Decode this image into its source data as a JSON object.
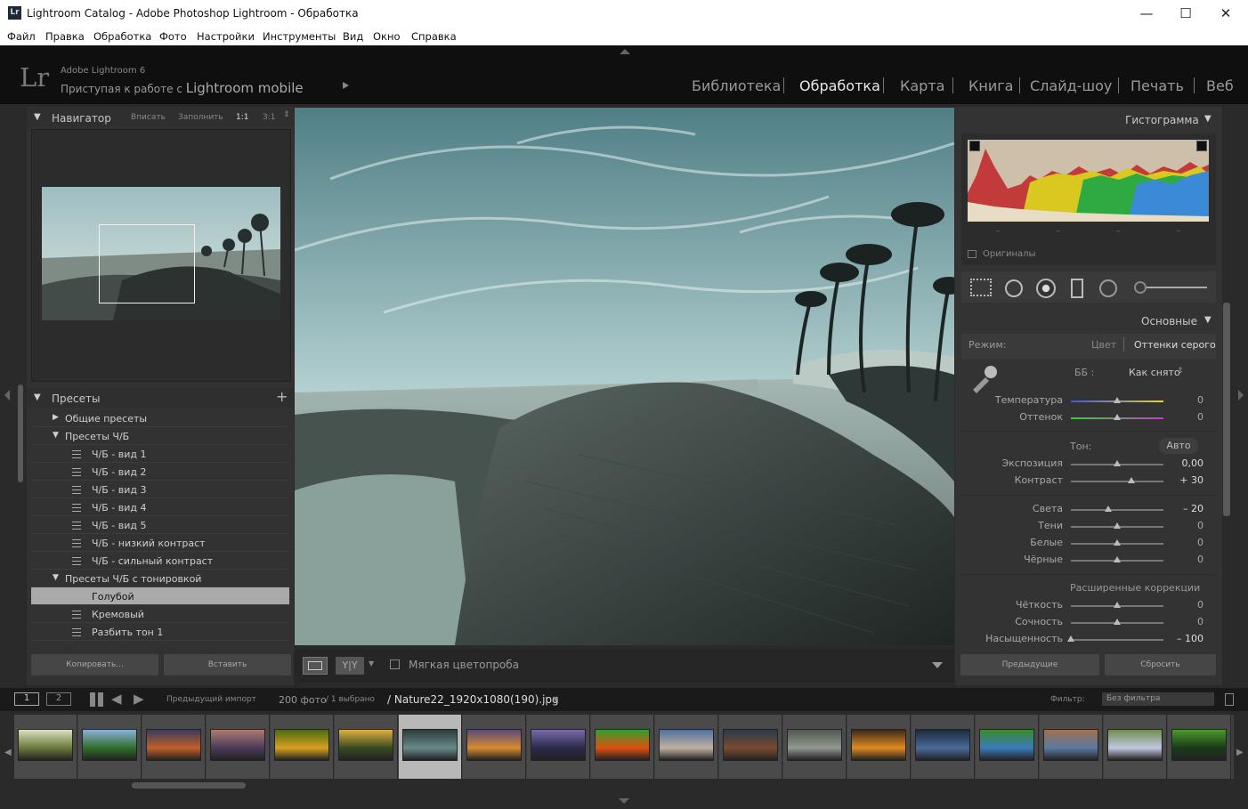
{
  "window": {
    "title": "Lightroom Catalog - Adobe Photoshop Lightroom - Обработка",
    "minimize": "—",
    "maximize": "☐",
    "close": "✕"
  },
  "menu": [
    "Файл",
    "Правка",
    "Обработка",
    "Фото",
    "Настройки",
    "Инструменты",
    "Вид",
    "Окно",
    "Справка"
  ],
  "identity": {
    "app": "Adobe Lightroom 6",
    "tagline_prefix": "Приступая к работе с",
    "tagline_mobile": "Lightroom mobile",
    "logo": "Lr"
  },
  "modules": [
    "Библиотека",
    "Обработка",
    "Карта",
    "Книга",
    "Слайд-шоу",
    "Печать",
    "Веб"
  ],
  "active_module": "Обработка",
  "navigator": {
    "title": "Навигатор",
    "fit": "Вписать",
    "fill": "Заполнить",
    "one": "1:1",
    "three": "3:1"
  },
  "presets": {
    "title": "Пресеты",
    "add": "+",
    "items": [
      {
        "label": "Общие пресеты",
        "type": "folder",
        "open": false
      },
      {
        "label": "Пресеты Ч/Б",
        "type": "folder",
        "open": true
      },
      {
        "label": "Ч/Б - вид 1",
        "type": "item"
      },
      {
        "label": "Ч/Б - вид 2",
        "type": "item"
      },
      {
        "label": "Ч/Б - вид 3",
        "type": "item"
      },
      {
        "label": "Ч/Б - вид 4",
        "type": "item"
      },
      {
        "label": "Ч/Б - вид 5",
        "type": "item"
      },
      {
        "label": "Ч/Б - низкий контраст",
        "type": "item"
      },
      {
        "label": "Ч/Б - сильный контраст",
        "type": "item"
      },
      {
        "label": "Пресеты Ч/Б с тонировкой",
        "type": "folder",
        "open": true
      },
      {
        "label": "Голубой",
        "type": "item",
        "selected": true
      },
      {
        "label": "Кремовый",
        "type": "item"
      },
      {
        "label": "Разбить тон 1",
        "type": "item"
      }
    ]
  },
  "left_buttons": {
    "copy": "Копировать...",
    "paste": "Вставить"
  },
  "toolbar": {
    "soft_proof": "Мягкая цветопроба",
    "yy": "Y|Y"
  },
  "histogram": {
    "title": "Гистограмма",
    "originals": "Оригиналы",
    "dashes": [
      "–",
      "–",
      "–",
      "–"
    ]
  },
  "basic": {
    "title": "Основные",
    "mode_label": "Режим:",
    "mode_color": "Цвет",
    "mode_gray": "Оттенки серого",
    "wb_label": "ББ :",
    "wb_value": "Как снято",
    "tone_label": "Тон:",
    "auto": "Авто",
    "adv_label": "Расширенные коррекции",
    "sliders": [
      {
        "label": "Температура",
        "value": "0",
        "pos": 0.5,
        "track": "temp"
      },
      {
        "label": "Оттенок",
        "value": "0",
        "pos": 0.5,
        "track": "tint"
      },
      {
        "label": "Экспозиция",
        "value": "0,00",
        "pos": 0.5
      },
      {
        "label": "Контраст",
        "value": "+ 30",
        "pos": 0.65
      },
      {
        "label": "Света",
        "value": "– 20",
        "pos": 0.4
      },
      {
        "label": "Тени",
        "value": "0",
        "pos": 0.5
      },
      {
        "label": "Белые",
        "value": "0",
        "pos": 0.5
      },
      {
        "label": "Чёрные",
        "value": "0",
        "pos": 0.5
      },
      {
        "label": "Чёткость",
        "value": "0",
        "pos": 0.5
      },
      {
        "label": "Сочность",
        "value": "0",
        "pos": 0.5
      },
      {
        "label": "Насыщенность",
        "value": "– 100",
        "pos": 0.0
      }
    ]
  },
  "right_buttons": {
    "previous": "Предыдущие",
    "reset": "Сбросить"
  },
  "filmstrip_header": {
    "view1": "1",
    "view2": "2",
    "source": "Предыдущий импорт",
    "count": "200 фото",
    "selected": "/ 1 выбрано",
    "filename": "/ Nature22_1920x1080(190).jpg",
    "filter_label": "Фильтр:",
    "filter_value": "Без фильтра"
  },
  "thumbs": [
    {
      "c1": "#6b7a3a",
      "c2": "#d8e0c0"
    },
    {
      "c1": "#2f6e2a",
      "c2": "#8ab0d8"
    },
    {
      "c1": "#c0602a",
      "c2": "#3a3a5a"
    },
    {
      "c1": "#4a3a5a",
      "c2": "#b07a70"
    },
    {
      "c1": "#d8a020",
      "c2": "#4a6a10"
    },
    {
      "c1": "#3a4a20",
      "c2": "#e0b040"
    },
    {
      "c1": "#6a8a8a",
      "c2": "#2a3a3a"
    },
    {
      "c1": "#d88a30",
      "c2": "#5a4a7a"
    },
    {
      "c1": "#2a2a4a",
      "c2": "#7a6aaa"
    },
    {
      "c1": "#e05010",
      "c2": "#30a030"
    },
    {
      "c1": "#c0b0a0",
      "c2": "#5070a0"
    },
    {
      "c1": "#7a4a30",
      "c2": "#2a3a4a"
    },
    {
      "c1": "#909890",
      "c2": "#505850"
    },
    {
      "c1": "#e08a20",
      "c2": "#3a2a1a"
    },
    {
      "c1": "#4a6a9a",
      "c2": "#1a2a3a"
    },
    {
      "c1": "#3a7aba",
      "c2": "#3a8a2a"
    },
    {
      "c1": "#5a7aa0",
      "c2": "#a07050"
    },
    {
      "c1": "#c0c8e0",
      "c2": "#708a50"
    },
    {
      "c1": "#1a3a1a",
      "c2": "#4a9a2a"
    }
  ]
}
